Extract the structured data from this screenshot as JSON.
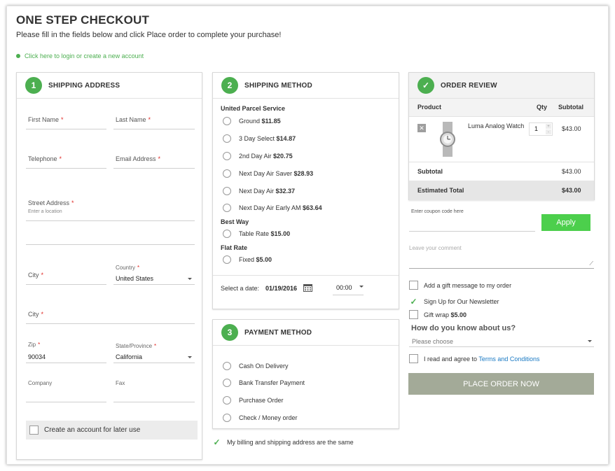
{
  "header": {
    "title": "ONE STEP CHECKOUT",
    "subtitle": "Please fill in the fields below and click Place order to complete your purchase!",
    "login_link": "Click here to login or create a new account"
  },
  "shipping_address": {
    "step": "1",
    "title": "SHIPPING ADDRESS",
    "first_name": "First Name",
    "last_name": "Last Name",
    "telephone": "Telephone",
    "email": "Email Address",
    "street": "Street Address",
    "street_placeholder": "Enter a location",
    "city": "City",
    "country_label": "Country",
    "country_value": "United States",
    "city2": "City",
    "zip_label": "Zip",
    "zip_value": "90034",
    "state_label": "State/Province",
    "state_value": "California",
    "company": "Company",
    "fax": "Fax",
    "create_account": "Create an account for later use",
    "required_mark": "*"
  },
  "shipping_method": {
    "step": "2",
    "title": "SHIPPING METHOD",
    "carriers": [
      {
        "name": "United Parcel Service",
        "options": [
          {
            "label": "Ground",
            "price": "$11.85"
          },
          {
            "label": "3 Day Select",
            "price": "$14.87"
          },
          {
            "label": "2nd Day Air",
            "price": "$20.75"
          },
          {
            "label": "Next Day Air Saver",
            "price": "$28.93"
          },
          {
            "label": "Next Day Air",
            "price": "$32.37"
          },
          {
            "label": "Next Day Air Early AM",
            "price": "$63.64"
          }
        ]
      },
      {
        "name": "Best Way",
        "options": [
          {
            "label": "Table Rate",
            "price": "$15.00"
          }
        ]
      },
      {
        "name": "Flat Rate",
        "options": [
          {
            "label": "Fixed",
            "price": "$5.00"
          }
        ]
      }
    ],
    "date_label": "Select a date:",
    "date_value": "01/19/2016",
    "time_value": "00:00"
  },
  "payment_method": {
    "step": "3",
    "title": "PAYMENT METHOD",
    "options": [
      "Cash On Delivery",
      "Bank Transfer Payment",
      "Purchase Order",
      "Check / Money order"
    ],
    "billing_same": "My billing and shipping address are the same"
  },
  "order_review": {
    "title": "ORDER REVIEW",
    "col_product": "Product",
    "col_qty": "Qty",
    "col_subtotal": "Subtotal",
    "item_name": "Luma Analog Watch",
    "item_qty": "1",
    "item_subtotal": "$43.00",
    "subtotal_label": "Subtotal",
    "subtotal_value": "$43.00",
    "total_label": "Estimated Total",
    "total_value": "$43.00",
    "coupon_placeholder": "Enter coupon code here",
    "apply_label": "Apply",
    "comment_placeholder": "Leave your comment",
    "gift_message": "Add a gift message to my order",
    "newsletter": "Sign Up for Our Newsletter",
    "gift_wrap": "Gift wrap",
    "gift_wrap_price": "$5.00",
    "how_know": "How do you know about us?",
    "please_choose": "Please choose",
    "agree_text": "I read and agree to",
    "terms_link": "Terms and Conditions",
    "place_order": "PLACE ORDER NOW"
  },
  "colors": {
    "accent": "#4caf50",
    "apply": "#4ccf4c",
    "order_button": "#a3aa98",
    "required": "#e02b27"
  }
}
